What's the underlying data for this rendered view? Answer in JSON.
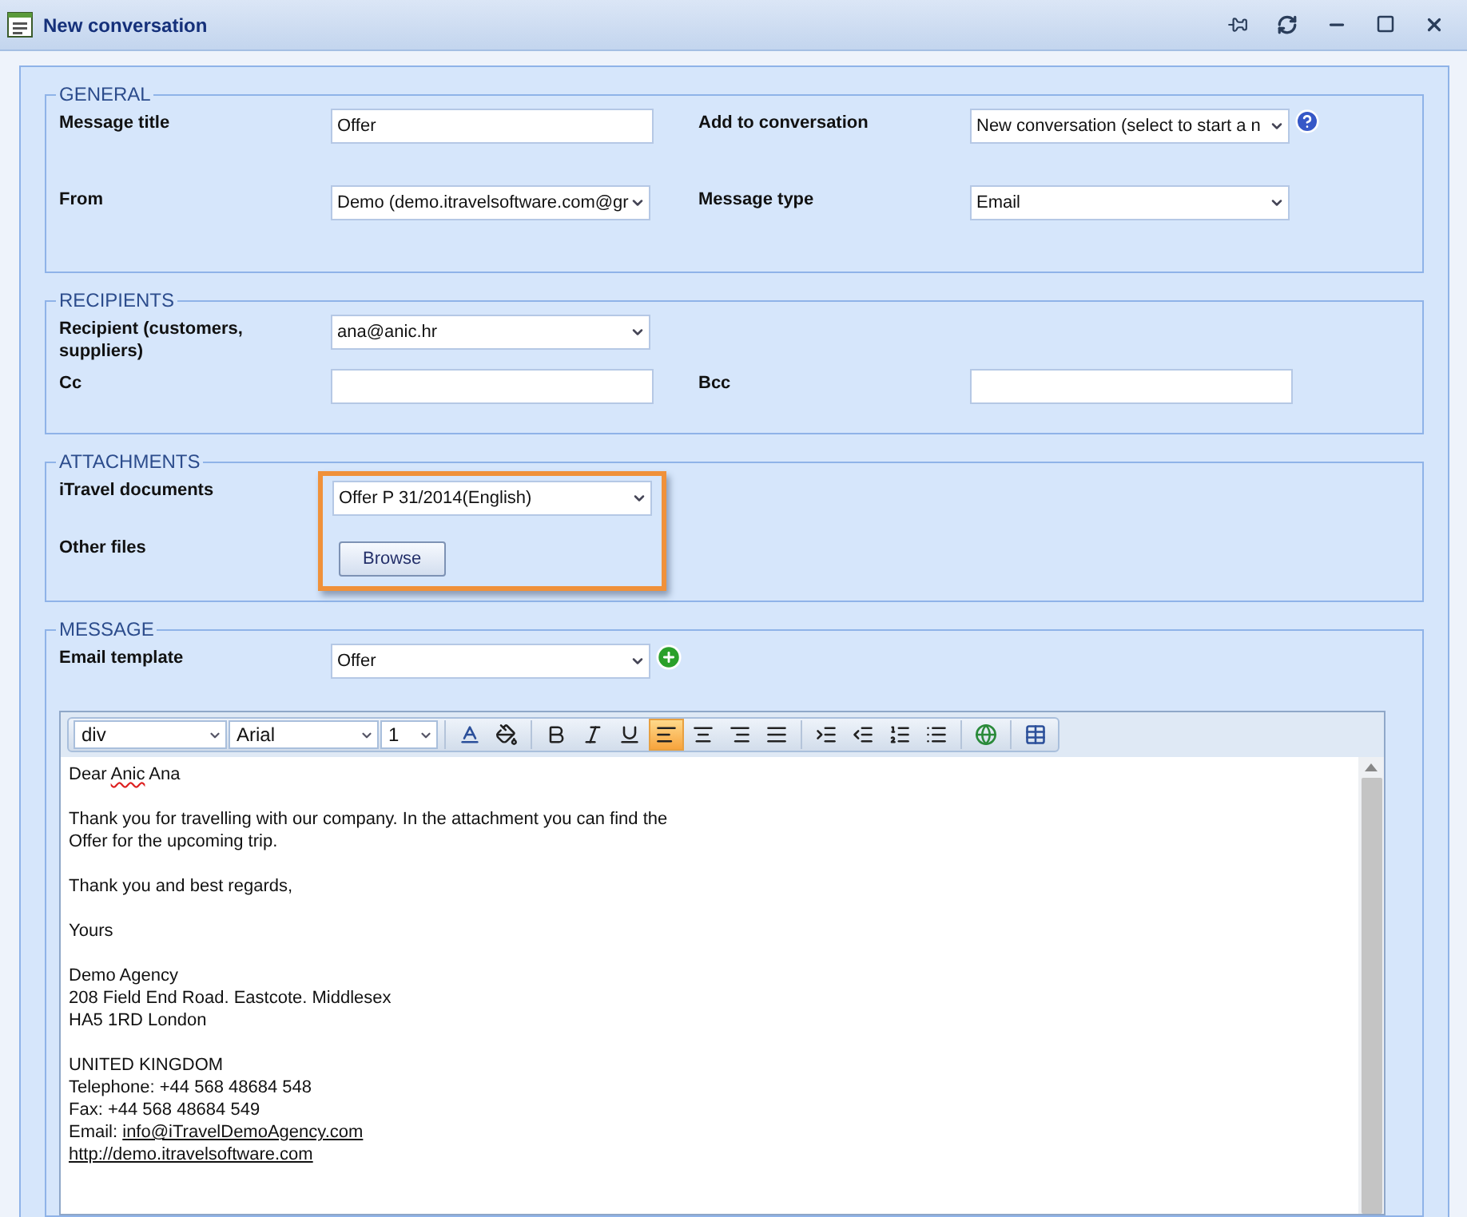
{
  "window": {
    "title": "New conversation"
  },
  "sections": [
    {
      "title": "GENERAL",
      "rows": [
        [
          {
            "label": "Message title",
            "kind": "text",
            "value": "Offer"
          },
          {
            "label": "Add to conversation",
            "kind": "select",
            "value": "New conversation (select to start a n",
            "help": true
          }
        ],
        [
          {
            "label": "From",
            "kind": "select",
            "value": "Demo (demo.itravelsoftware.com@gr"
          },
          {
            "label": "Message type",
            "kind": "select",
            "value": "Email"
          }
        ]
      ]
    },
    {
      "title": "RECIPIENTS",
      "rows": [
        [
          {
            "label": "Recipient (customers, suppliers)",
            "kind": "select",
            "value": "ana@anic.hr"
          }
        ],
        [
          {
            "label": "Cc",
            "kind": "text"
          },
          {
            "label": "Bcc",
            "kind": "text"
          }
        ]
      ]
    },
    {
      "title": "ATTACHMENTS",
      "highlighted": true,
      "rows": [
        [
          {
            "label": "iTravel documents",
            "kind": "select",
            "value": "Offer P 31/2014(English)"
          }
        ],
        [
          {
            "label": "Other files",
            "kind": "button",
            "value": "Browse"
          }
        ]
      ]
    },
    {
      "title": "MESSAGE",
      "rows": [
        [
          {
            "label": "Email template",
            "kind": "select",
            "value": "Offer",
            "add": true
          }
        ]
      ]
    }
  ],
  "editor": {
    "dropdowns": [
      "div",
      "Arial",
      "1"
    ],
    "tool_groups": [
      [
        {
          "kind": "font-color",
          "selected": false
        },
        {
          "kind": "fill-color",
          "selected": false
        }
      ],
      [
        {
          "kind": "bold",
          "selected": false
        },
        {
          "kind": "italic",
          "selected": false
        },
        {
          "kind": "underline",
          "selected": false
        },
        {
          "kind": "align-left",
          "selected": true
        },
        {
          "kind": "align-center",
          "selected": false
        },
        {
          "kind": "align-right",
          "selected": false
        },
        {
          "kind": "justify",
          "selected": false
        }
      ],
      [
        {
          "kind": "indent",
          "selected": false
        },
        {
          "kind": "outdent",
          "selected": false
        },
        {
          "kind": "ordered-list",
          "selected": false
        },
        {
          "kind": "bullet-list",
          "selected": false
        }
      ],
      [
        {
          "kind": "link",
          "selected": false
        }
      ],
      [
        {
          "kind": "table",
          "selected": false
        }
      ]
    ],
    "paragraphs": [
      [
        [
          {
            "text": "Dear "
          },
          {
            "text": "Anic",
            "misspelled": true
          },
          {
            "text": " Ana"
          }
        ]
      ],
      [
        [
          {
            "text": "Thank you for travelling with our company. In the attachment you can find the"
          }
        ],
        [
          {
            "text": "Offer for the upcoming trip."
          }
        ]
      ],
      [
        [
          {
            "text": "Thank you and best regards,"
          }
        ]
      ],
      [
        [
          {
            "text": "Yours"
          }
        ]
      ],
      [
        [
          {
            "text": "Demo Agency"
          }
        ],
        [
          {
            "text": "208 Field End Road. Eastcote. Middlesex"
          }
        ],
        [
          {
            "text": "HA5 1RD London"
          }
        ]
      ],
      [
        [
          {
            "text": "UNITED KINGDOM"
          }
        ],
        [
          {
            "text": "Telephone: +44 568 48684 548"
          }
        ],
        [
          {
            "text": "Fax: +44 568 48684 549"
          }
        ],
        [
          {
            "text": "Email: "
          },
          {
            "text": "info@iTravelDemoAgency.com",
            "link": true
          }
        ],
        [
          {
            "text": "http://demo.itravelsoftware.com",
            "link": true
          }
        ]
      ]
    ]
  }
}
